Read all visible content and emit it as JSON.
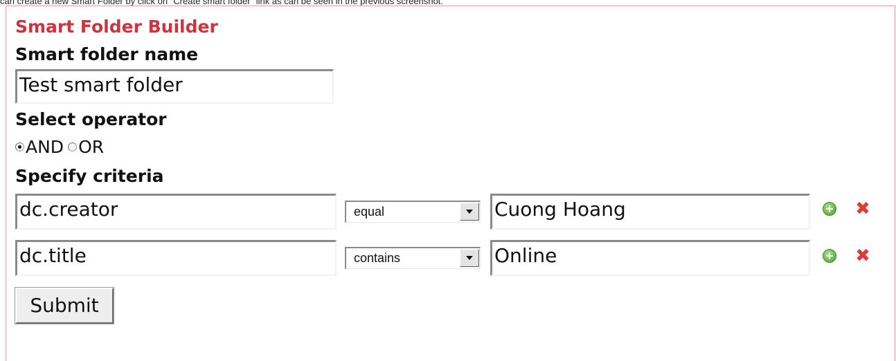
{
  "caption": "can create a new Smart Folder by click on \"Create smart folder\" link as can be seen in the previous screenshot.",
  "builder": {
    "title": "Smart Folder Builder",
    "name_label": "Smart folder name",
    "name_value": "Test smart folder",
    "operator_label": "Select operator",
    "operators": [
      {
        "label": "AND",
        "checked": true
      },
      {
        "label": "OR",
        "checked": false
      }
    ],
    "criteria_label": "Specify criteria",
    "criteria": [
      {
        "field": "dc.creator",
        "operator": "equal",
        "value": "Cuong Hoang"
      },
      {
        "field": "dc.title",
        "operator": "contains",
        "value": "Online"
      }
    ],
    "submit_label": "Submit"
  },
  "colors": {
    "title": "#c9363e",
    "panel_border": "#e8a0a4",
    "add_icon": "#6fc04f",
    "remove_icon": "#e23a35"
  },
  "icons": {
    "add": "plus-circle-icon",
    "remove": "red-x-icon"
  }
}
